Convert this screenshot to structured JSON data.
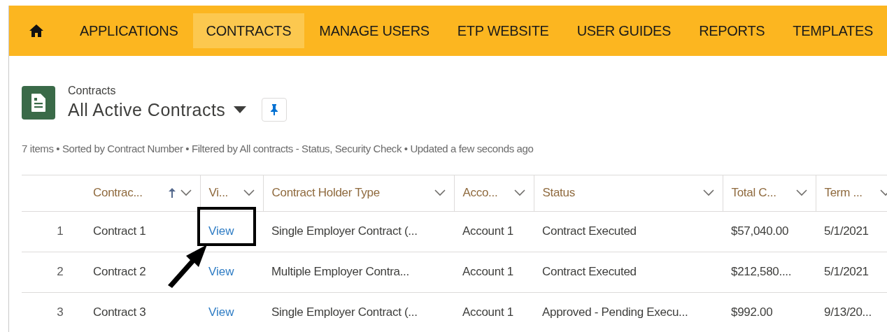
{
  "nav": {
    "items": [
      {
        "label": "APPLICATIONS",
        "selected": false
      },
      {
        "label": "CONTRACTS",
        "selected": true
      },
      {
        "label": "MANAGE USERS",
        "selected": false
      },
      {
        "label": "ETP WEBSITE",
        "selected": false
      },
      {
        "label": "USER GUIDES",
        "selected": false
      },
      {
        "label": "REPORTS",
        "selected": false
      },
      {
        "label": "TEMPLATES",
        "selected": false
      }
    ]
  },
  "header": {
    "object_label": "Contracts",
    "list_view": "All Active Contracts"
  },
  "summary": "7 items • Sorted by Contract Number • Filtered by All contracts - Status, Security Check • Updated a few seconds ago",
  "table": {
    "columns": [
      {
        "label": "Contrac...",
        "sorted": true
      },
      {
        "label": "Vi...",
        "sorted": false
      },
      {
        "label": "Contract Holder Type",
        "sorted": false
      },
      {
        "label": "Acco...",
        "sorted": false
      },
      {
        "label": "Status",
        "sorted": false
      },
      {
        "label": "Total C...",
        "sorted": false
      },
      {
        "label": "Term ...",
        "sorted": false
      }
    ],
    "rows": [
      {
        "number": "1",
        "cells": [
          "Contract 1",
          "View",
          "Single Employer Contract (...",
          "Account 1",
          "Contract Executed",
          "$57,040.00",
          "5/1/2021"
        ],
        "highlighted": true
      },
      {
        "number": "2",
        "cells": [
          "Contract 2",
          "View",
          "Multiple Employer Contra...",
          "Account 1",
          "Contract Executed",
          "$212,580....",
          "5/1/2021"
        ],
        "highlighted": false
      },
      {
        "number": "3",
        "cells": [
          "Contract 3",
          "View",
          "Single Employer Contract (...",
          "Account 1",
          "Approved - Pending Execu...",
          "$992.00",
          "9/13/20..."
        ],
        "highlighted": false
      }
    ]
  }
}
